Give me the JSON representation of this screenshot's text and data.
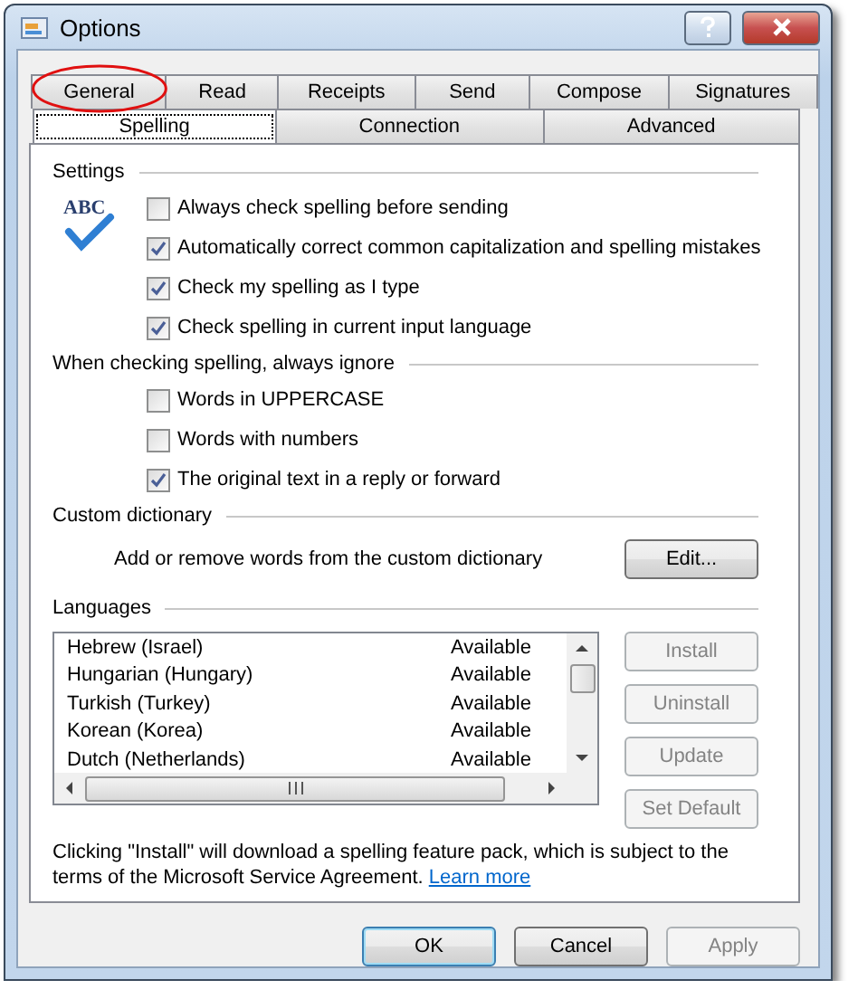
{
  "window": {
    "title": "Options"
  },
  "tabs_row_1": [
    {
      "label": "General",
      "selected": false
    },
    {
      "label": "Read",
      "selected": false
    },
    {
      "label": "Receipts",
      "selected": false
    },
    {
      "label": "Send",
      "selected": false
    },
    {
      "label": "Compose",
      "selected": false
    },
    {
      "label": "Signatures",
      "selected": false
    }
  ],
  "tabs_row_2": [
    {
      "label": "Spelling",
      "selected": true
    },
    {
      "label": "Connection",
      "selected": false
    },
    {
      "label": "Advanced",
      "selected": false
    }
  ],
  "settings": {
    "label": "Settings",
    "icon_text": "ABC",
    "options": [
      {
        "label": "Always check spelling before sending",
        "checked": false
      },
      {
        "label": "Automatically correct common capitalization and spelling mistakes",
        "checked": true
      },
      {
        "label": "Check my spelling as I type",
        "checked": true
      },
      {
        "label": "Check spelling in current input language",
        "checked": true
      }
    ]
  },
  "ignore": {
    "label": "When checking spelling, always ignore",
    "options": [
      {
        "label": "Words in UPPERCASE",
        "checked": false
      },
      {
        "label": "Words with numbers",
        "checked": false
      },
      {
        "label": "The original text in a reply or forward",
        "checked": true
      }
    ]
  },
  "custom_dictionary": {
    "label": "Custom dictionary",
    "description": "Add or remove words from the custom dictionary",
    "button": "Edit..."
  },
  "languages": {
    "label": "Languages",
    "rows": [
      {
        "name": "Hebrew (Israel)",
        "status": "Available"
      },
      {
        "name": "Hungarian (Hungary)",
        "status": "Available"
      },
      {
        "name": "Turkish (Turkey)",
        "status": "Available"
      },
      {
        "name": "Korean (Korea)",
        "status": "Available"
      },
      {
        "name": "Dutch (Netherlands)",
        "status": "Available"
      }
    ],
    "buttons": [
      {
        "label": "Install",
        "disabled": true
      },
      {
        "label": "Uninstall",
        "disabled": true
      },
      {
        "label": "Update",
        "disabled": true
      },
      {
        "label": "Set Default",
        "disabled": true
      }
    ]
  },
  "note": {
    "text": "Clicking \"Install\" will download a spelling feature pack, which is subject to the terms of the Microsoft Service Agreement.",
    "link": "Learn more"
  },
  "buttons": [
    {
      "label": "OK",
      "disabled": false
    },
    {
      "label": "Cancel",
      "disabled": false
    },
    {
      "label": "Apply",
      "disabled": true
    }
  ]
}
